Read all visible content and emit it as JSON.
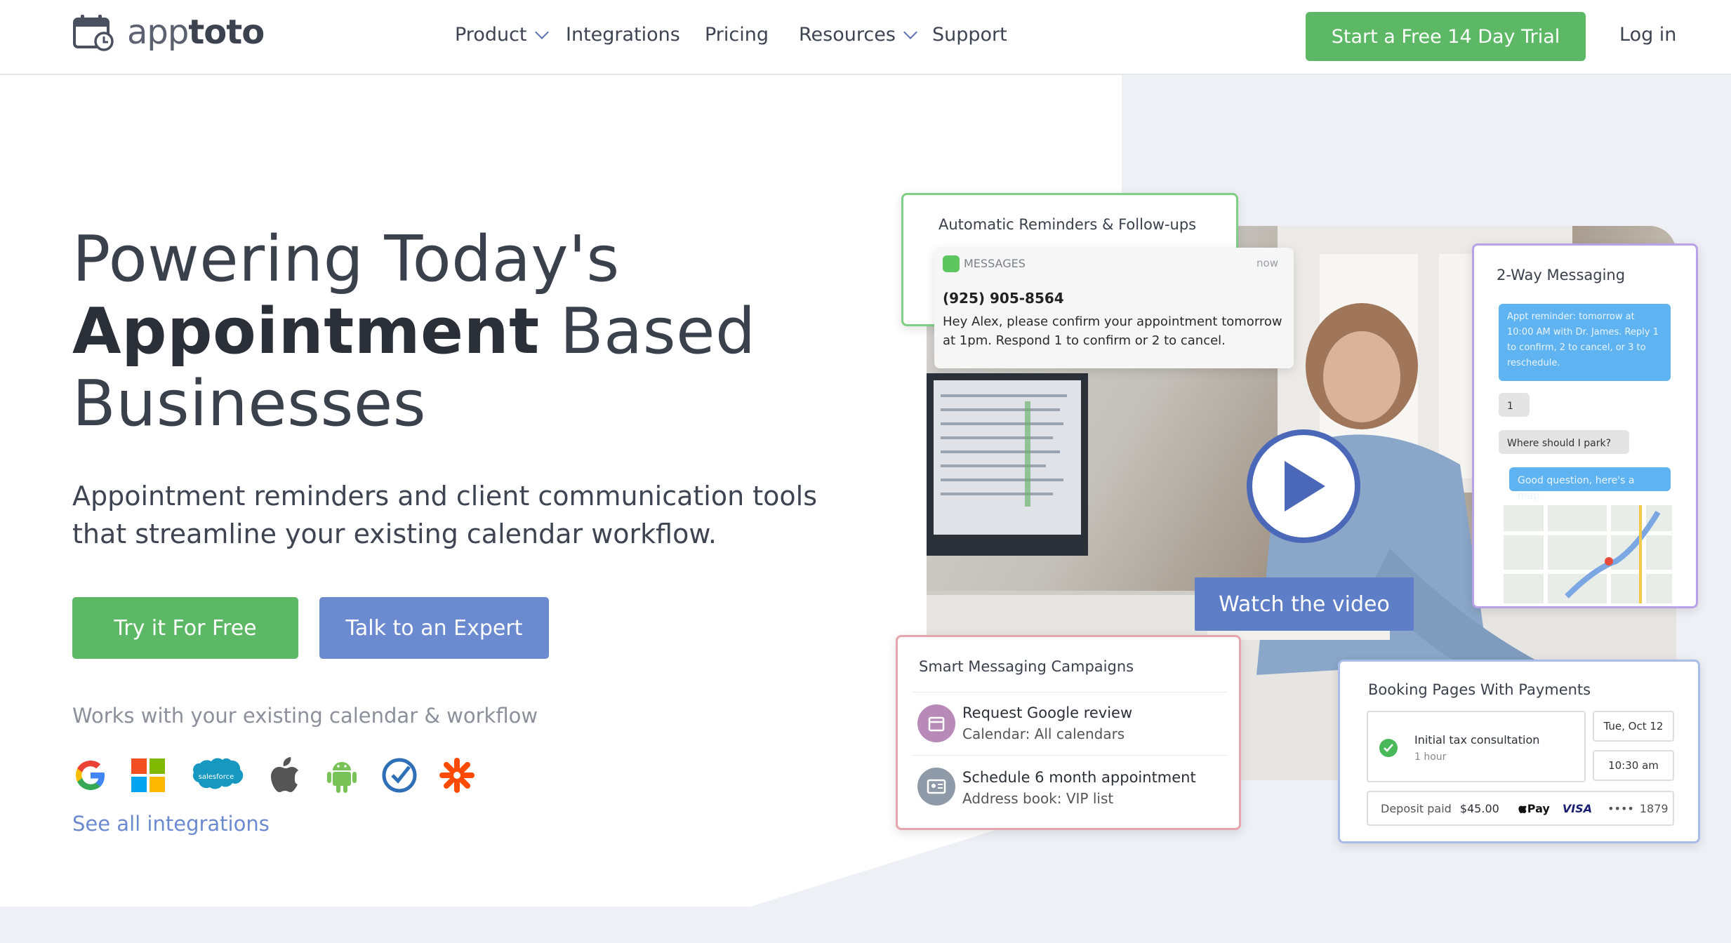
{
  "header": {
    "logo_text_light": "app",
    "logo_text_bold": "toto",
    "nav": [
      {
        "label": "Product",
        "has_dropdown": true
      },
      {
        "label": "Integrations",
        "has_dropdown": false
      },
      {
        "label": "Pricing",
        "has_dropdown": false
      },
      {
        "label": "Resources",
        "has_dropdown": true
      },
      {
        "label": "Support",
        "has_dropdown": false
      }
    ],
    "cta_label": "Start a Free 14 Day Trial",
    "login_label": "Log in"
  },
  "hero": {
    "title_line1": "Powering Today's",
    "title_bold": "Appointment",
    "title_line2_rest": " Based",
    "title_line3": "Businesses",
    "subtitle": "Appointment reminders and client communication tools that streamline your existing calendar workflow.",
    "primary_button": "Try it For Free",
    "secondary_button": "Talk to an Expert",
    "works_with": "Works with your existing calendar & workflow",
    "integrations": [
      "google-icon",
      "microsoft-icon",
      "salesforce-icon",
      "apple-icon",
      "android-icon",
      "check-circle-icon",
      "zapier-icon"
    ],
    "salesforce_label": "salesforce",
    "see_all": "See all integrations"
  },
  "collage": {
    "reminders_card": {
      "title": "Automatic Reminders & Follow-ups",
      "app_label": "MESSAGES",
      "time": "now",
      "phone": "(925) 905-8564",
      "message": "Hey Alex, please confirm your appointment tomorrow at 1pm. Respond 1 to confirm or 2 to cancel."
    },
    "two_way_card": {
      "title": "2-Way Messaging",
      "msg1": "Appt reminder: tomorrow at 10:00 AM with Dr. James. Reply 1 to confirm, 2 to cancel, or 3 to reschedule.",
      "msg2": "1",
      "msg3": "Where should I park?",
      "msg4": "Good question, here's a map:"
    },
    "video_label": "Watch the video",
    "campaigns_card": {
      "title": "Smart Messaging Campaigns",
      "items": [
        {
          "title": "Request Google review",
          "sub": "Calendar: All calendars"
        },
        {
          "title": "Schedule 6 month appointment",
          "sub": "Address book: VIP list"
        }
      ]
    },
    "booking_card": {
      "title": "Booking Pages With Payments",
      "service": "Initial tax consultation",
      "duration": "1 hour",
      "date": "Tue, Oct 12",
      "time": "10:30 am",
      "deposit_label": "Deposit paid",
      "deposit_amount": "$45.00",
      "pay_label": "Pay",
      "visa": "VISA",
      "card_dots": "••••",
      "card_last4": "1879"
    }
  },
  "colors": {
    "green": "#5cb865",
    "blue": "#6b8ad0",
    "dark_blue": "#4a67b8",
    "text": "#3b404d",
    "muted": "#8b909b",
    "light_bg": "#eef0f6"
  }
}
